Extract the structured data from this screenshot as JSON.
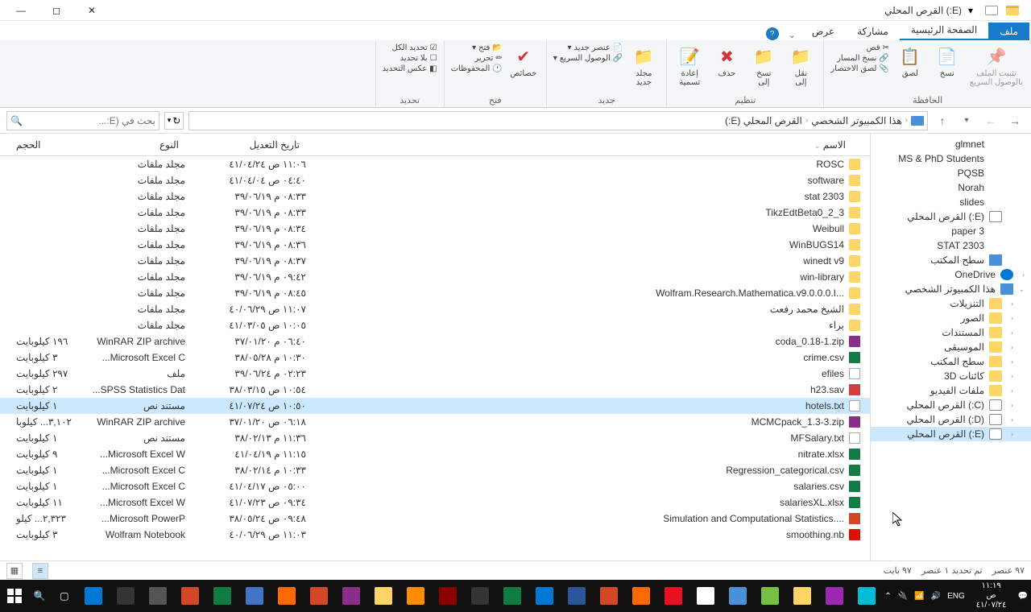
{
  "window": {
    "title": "(E:) القرص المحلي"
  },
  "tabs": {
    "file": "ملف",
    "home": "الصفحة الرئيسية",
    "share": "مشاركة",
    "view": "عرض"
  },
  "ribbon": {
    "clipboard": {
      "label": "الحافظة",
      "pin": "تثبيت الملف\nبالوصول السريع",
      "copy": "نسخ",
      "paste": "لصق",
      "cut": "قص",
      "copypath": "نسخ المسار",
      "pasteshort": "لصق الاختصار"
    },
    "organize": {
      "label": "تنظيم",
      "moveto": "نقل\nإلى",
      "copyto": "نسخ\nإلى",
      "delete": "حذف",
      "rename": "إعادة\nتسمية"
    },
    "new": {
      "label": "جديد",
      "newfolder": "مجلد\nجديد",
      "newitem": "عنصر جديد",
      "easyaccess": "الوصول السريع"
    },
    "open": {
      "label": "فتح",
      "props": "خصائص",
      "open": "فتح",
      "edit": "تحرير",
      "history": "المحفوظات"
    },
    "select": {
      "label": "تحديد",
      "all": "تحديد الكل",
      "none": "بلا تحديد",
      "invert": "عكس التحديد"
    }
  },
  "nav": {
    "back": "◄",
    "fwd": "►",
    "up": "▲"
  },
  "breadcrumb": {
    "pc": "هذا الكمبيوتر الشخصي",
    "drive": "القرص المحلي (E:)"
  },
  "search": {
    "placeholder": "بحث في (E:...",
    "refresh": "↻"
  },
  "columns": {
    "name": "الاسم",
    "date": "تاريخ التعديل",
    "type": "النوع",
    "size": "الحجم"
  },
  "treenav": [
    {
      "label": "glmnet",
      "icon": "pin",
      "indent": 1
    },
    {
      "label": "MS & PhD Students",
      "icon": "pin",
      "indent": 1
    },
    {
      "label": "PQSB",
      "icon": "pin",
      "indent": 1
    },
    {
      "label": "Norah",
      "icon": "pin",
      "indent": 1
    },
    {
      "label": "slides",
      "icon": "pin",
      "indent": 1
    },
    {
      "label": "(E:) القرص المحلي",
      "icon": "drive",
      "indent": 1
    },
    {
      "label": "paper 3",
      "icon": "pin",
      "indent": 1
    },
    {
      "label": "STAT 2303",
      "icon": "pin",
      "indent": 1
    },
    {
      "label": "سطح المكتب",
      "icon": "desktop",
      "indent": 1
    },
    {
      "label": "OneDrive",
      "icon": "cloud",
      "indent": 0,
      "chev": true
    },
    {
      "label": "هذا الكمبيوتر الشخصي",
      "icon": "pc",
      "indent": 0,
      "chev": true,
      "expanded": true
    },
    {
      "label": "التنزيلات",
      "icon": "folder",
      "indent": 1,
      "chev": true
    },
    {
      "label": "الصور",
      "icon": "folder",
      "indent": 1,
      "chev": true
    },
    {
      "label": "المستندات",
      "icon": "folder",
      "indent": 1,
      "chev": true
    },
    {
      "label": "الموسيقى",
      "icon": "folder",
      "indent": 1,
      "chev": true
    },
    {
      "label": "سطح المكتب",
      "icon": "folder",
      "indent": 1,
      "chev": true
    },
    {
      "label": "كائنات 3D",
      "icon": "folder",
      "indent": 1,
      "chev": true
    },
    {
      "label": "ملفات الفيديو",
      "icon": "folder",
      "indent": 1,
      "chev": true
    },
    {
      "label": "(C:) القرص المحلي",
      "icon": "drive",
      "indent": 1,
      "chev": true
    },
    {
      "label": "(D:) القرص المحلي",
      "icon": "drive",
      "indent": 1,
      "chev": true
    },
    {
      "label": "(E:) القرص المحلي",
      "icon": "drive",
      "indent": 1,
      "chev": true,
      "selected": true
    }
  ],
  "files": [
    {
      "name": "ROSC",
      "date": "١١:٠٦ ص ٤١/٠٤/٢٤",
      "type": "مجلد ملفات",
      "size": "",
      "icon": "folder"
    },
    {
      "name": "software",
      "date": "٠٤:٤٠ ص ٤١/٠٤/٠٤",
      "type": "مجلد ملفات",
      "size": "",
      "icon": "folder"
    },
    {
      "name": "stat 2303",
      "date": "٠٨:٣٣ م ٣٩/٠٦/١٩",
      "type": "مجلد ملفات",
      "size": "",
      "icon": "folder"
    },
    {
      "name": "TikzEdtBeta0_2_3",
      "date": "٠٨:٣٣ م ٣٩/٠٦/١٩",
      "type": "مجلد ملفات",
      "size": "",
      "icon": "folder"
    },
    {
      "name": "Weibull",
      "date": "٠٨:٣٤ م ٣٩/٠٦/١٩",
      "type": "مجلد ملفات",
      "size": "",
      "icon": "folder"
    },
    {
      "name": "WinBUGS14",
      "date": "٠٨:٣٦ م ٣٩/٠٦/١٩",
      "type": "مجلد ملفات",
      "size": "",
      "icon": "folder"
    },
    {
      "name": "winedt v9",
      "date": "٠٨:٣٧ م ٣٩/٠٦/١٩",
      "type": "مجلد ملفات",
      "size": "",
      "icon": "folder"
    },
    {
      "name": "win-library",
      "date": "٠٩:٤٢ م ٣٩/٠٦/١٩",
      "type": "مجلد ملفات",
      "size": "",
      "icon": "folder"
    },
    {
      "name": "Wolfram.Research.Mathematica.v9.0.0.0.I...",
      "date": "٠٨:٤٥ م ٣٩/٠٦/١٩",
      "type": "مجلد ملفات",
      "size": "",
      "icon": "folder"
    },
    {
      "name": "الشيخ محمد رفعت",
      "date": "١١:٠٧ ص ٤٠/٠٦/٢٩",
      "type": "مجلد ملفات",
      "size": "",
      "icon": "folder"
    },
    {
      "name": "براء",
      "date": "١٠:٠٥ ص ٤١/٠٣/٠٥",
      "type": "مجلد ملفات",
      "size": "",
      "icon": "folder"
    },
    {
      "name": "coda_0.18-1.zip",
      "date": "٠٦:٤٠ م ٣٧/٠١/٢٠",
      "type": "WinRAR ZIP archive",
      "size": "١٩٦ كيلوبايت",
      "icon": "zip"
    },
    {
      "name": "crime.csv",
      "date": "١٠:٣٠ م ٣٨/٠٥/٢٨",
      "type": "Microsoft Excel C...",
      "size": "٣ كيلوبايت",
      "icon": "csv"
    },
    {
      "name": "efiles",
      "date": "٠٢:٢٣ م ٣٩/٠٦/٢٤",
      "type": "ملف",
      "size": "٢٩٧ كيلوبايت",
      "icon": "file"
    },
    {
      "name": "h23.sav",
      "date": "١٠:٥٤ ص ٣٨/٠٣/١٥",
      "type": "SPSS Statistics Dat...",
      "size": "٢ كيلوبايت",
      "icon": "sav"
    },
    {
      "name": "hotels.txt",
      "date": "١٠:٥٠ ص ٤١/٠٧/٢٤",
      "type": "مستند نص",
      "size": "١ كيلوبايت",
      "icon": "txt",
      "selected": true
    },
    {
      "name": "MCMCpack_1.3-3.zip",
      "date": "٠٦:١٨ ص ٣٧/٠١/٢٠",
      "type": "WinRAR ZIP archive",
      "size": "٣,١٠٢... كيلوبا",
      "icon": "zip"
    },
    {
      "name": "MFSalary.txt",
      "date": "١١:٣٦ م ٣٨/٠٢/١٣",
      "type": "مستند نص",
      "size": "١ كيلوبايت",
      "icon": "txt"
    },
    {
      "name": "nitrate.xlsx",
      "date": "١١:١٥ م ٤١/٠٤/١٩",
      "type": "Microsoft Excel W...",
      "size": "٩ كيلوبايت",
      "icon": "xlsx"
    },
    {
      "name": "Regression_categorical.csv",
      "date": "١٠:٣٣ م ٣٨/٠٢/١٤",
      "type": "Microsoft Excel C...",
      "size": "١ كيلوبايت",
      "icon": "csv"
    },
    {
      "name": "salaries.csv",
      "date": "٠٥:٠٠ ص ٤١/٠٤/١٧",
      "type": "Microsoft Excel C...",
      "size": "١ كيلوبايت",
      "icon": "csv"
    },
    {
      "name": "salariesXL.xlsx",
      "date": "٠٩:٣٤ ص ٤١/٠٧/٢٣",
      "type": "Microsoft Excel W...",
      "size": "١١ كيلوبايت",
      "icon": "xlsx"
    },
    {
      "name": "Simulation and Computational Statistics....",
      "date": "٠٩:٤٨ ص ٣٨/٠٥/٢٤",
      "type": "Microsoft PowerP...",
      "size": "٢,٣٢٣... كيلو",
      "icon": "ppt"
    },
    {
      "name": "smoothing.nb",
      "date": "١١:٠٣ ص ٤٠/٠٦/٢٩",
      "type": "Wolfram Notebook",
      "size": "٣ كيلوبايت",
      "icon": "nb"
    }
  ],
  "status": {
    "items": "٩٧ عنصر",
    "selected": "تم تحديد ١ عنصر",
    "bytes": "٩٧ بايت"
  },
  "tray": {
    "lang": "ENG",
    "time": "١١:١٩ ص",
    "date": "٤١/٠٧/٢٤"
  },
  "taskbar_apps": [
    "#0078d4",
    "#333",
    "#555",
    "#d24726",
    "#107c41",
    "#4472c4",
    "#ff6a00",
    "#d24726",
    "#8b2d8b",
    "#ffd666",
    "#ff8c00",
    "#8b0000",
    "#333",
    "#107c41",
    "#0078d4",
    "#2b579a",
    "#d24726",
    "#ff6a00",
    "#e81123",
    "#fff",
    "#4a90d9",
    "#76c043",
    "#ffd666",
    "#9c27b0",
    "#00bcd4"
  ]
}
